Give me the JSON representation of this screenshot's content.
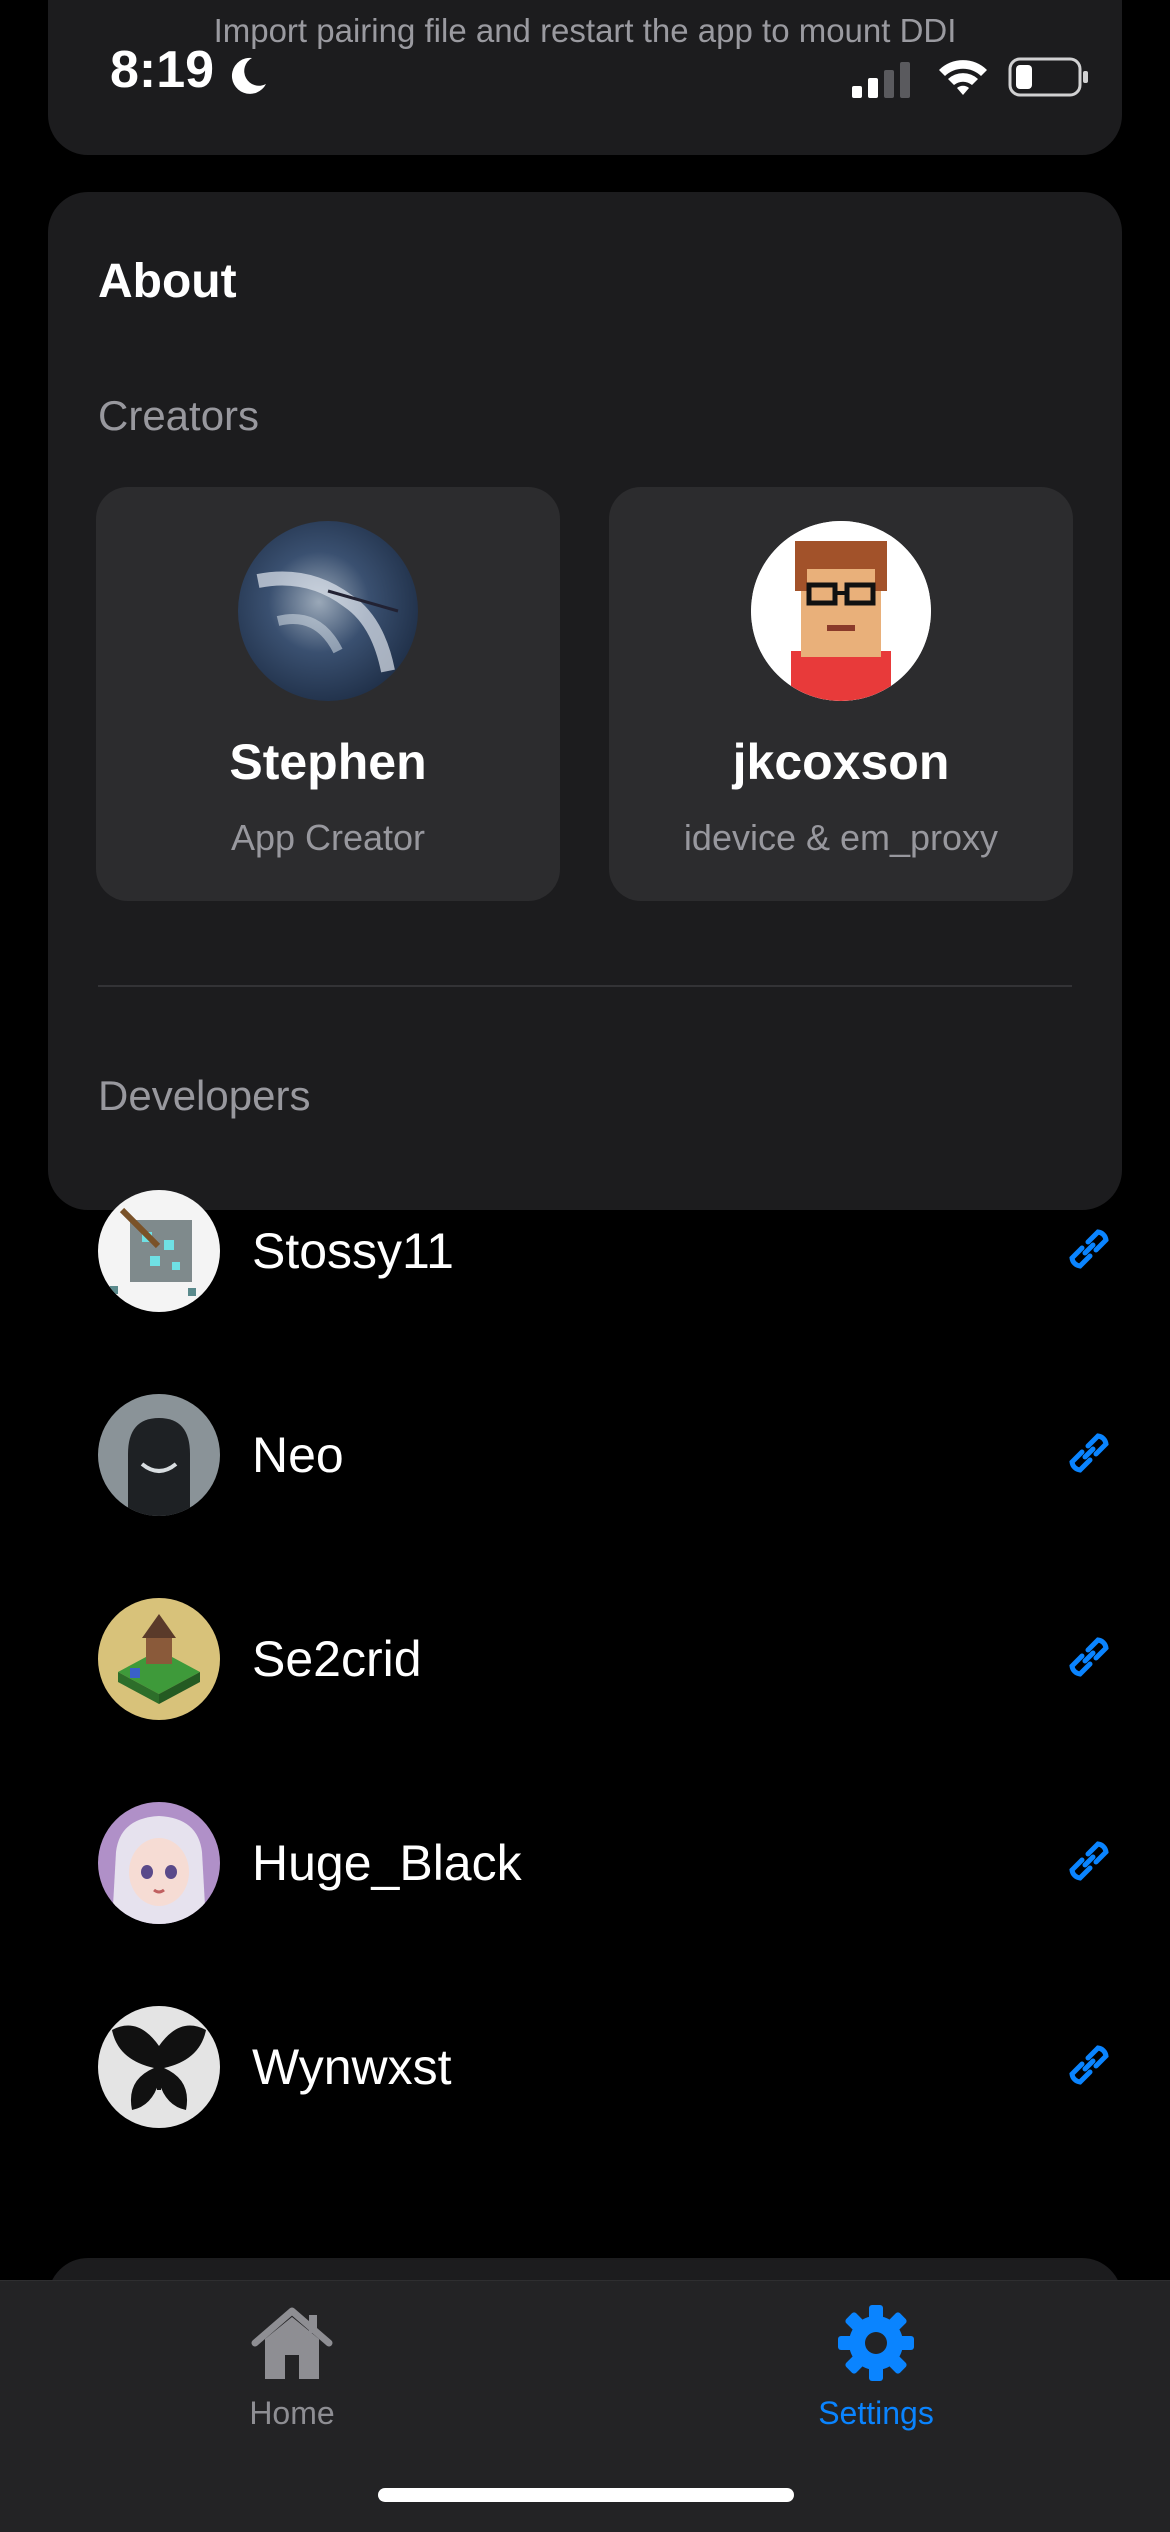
{
  "status_bar": {
    "time": "8:19"
  },
  "top_card": {
    "message": "Import pairing file and restart the app to mount DDI"
  },
  "about": {
    "title": "About",
    "creators_label": "Creators",
    "creators": [
      {
        "name": "Stephen",
        "role": "App Creator"
      },
      {
        "name": "jkcoxson",
        "role": "idevice & em_proxy"
      }
    ],
    "developers_label": "Developers",
    "developers": [
      {
        "name": "Stossy11"
      },
      {
        "name": "Neo"
      },
      {
        "name": "Se2crid"
      },
      {
        "name": "Huge_Black"
      },
      {
        "name": "Wynwxst"
      }
    ]
  },
  "tab_bar": {
    "tabs": [
      {
        "label": "Home",
        "icon": "house-icon",
        "selected": false
      },
      {
        "label": "Settings",
        "icon": "gear-icon",
        "selected": true
      }
    ]
  },
  "colors": {
    "accent": "#0a84ff",
    "card": "#1c1c1e",
    "subcard": "#2c2c2e"
  }
}
